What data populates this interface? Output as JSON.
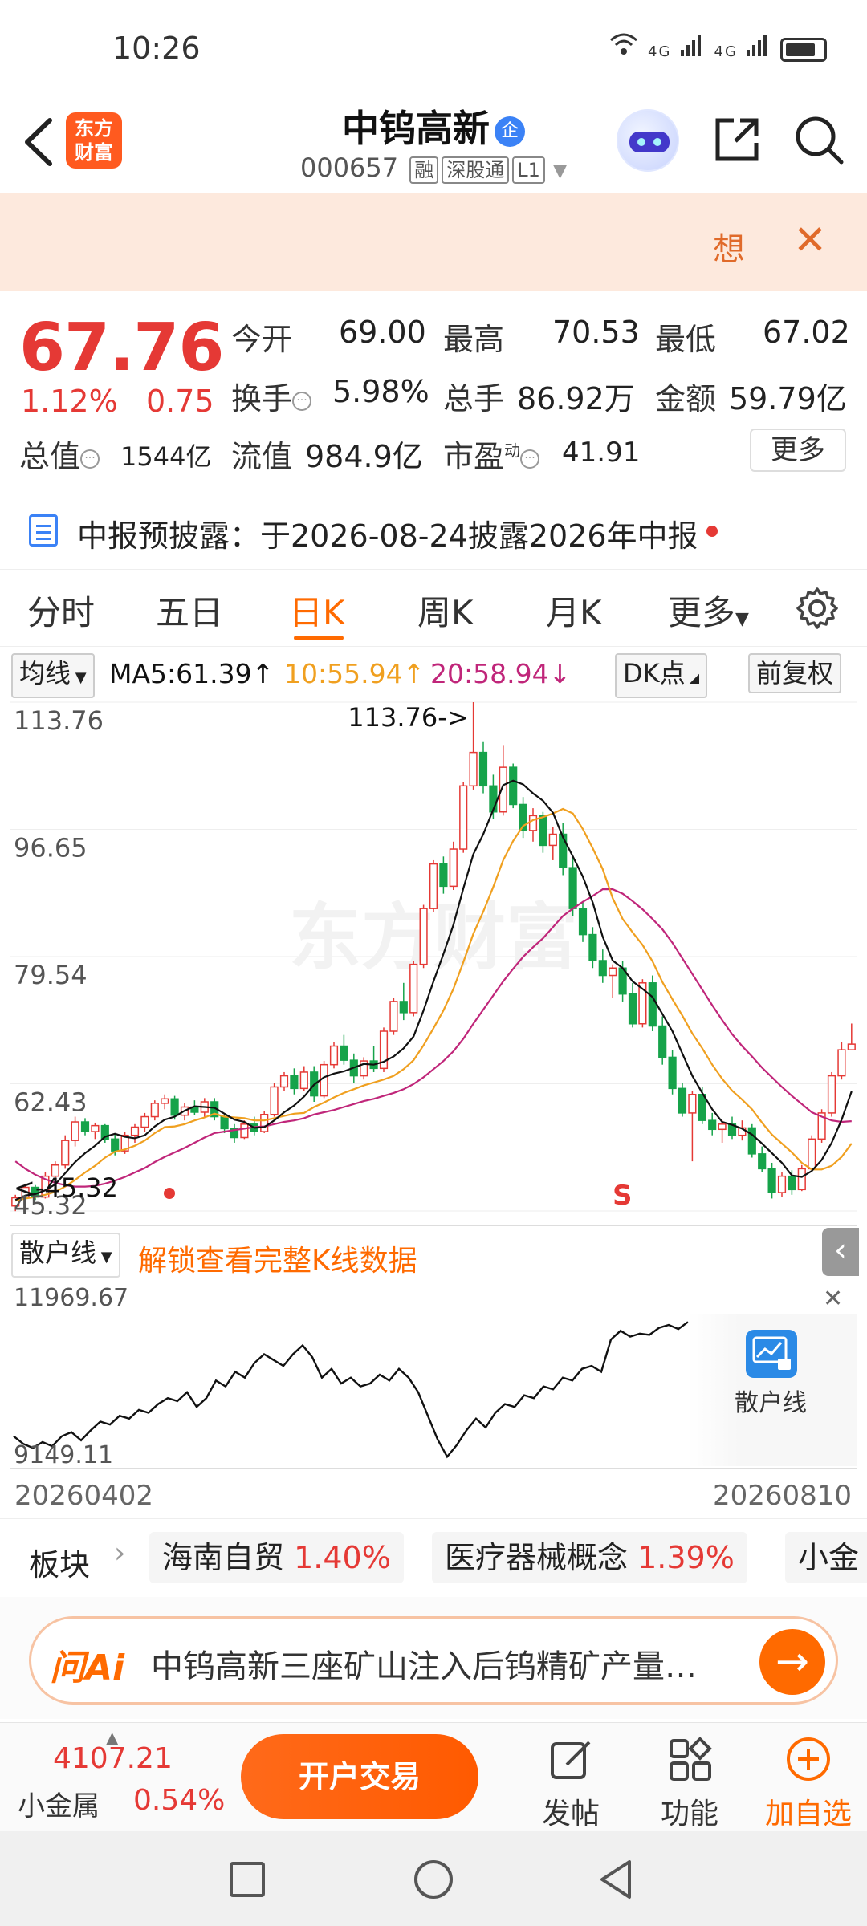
{
  "status_bar": {
    "time": "10:26",
    "network": "4G 4G"
  },
  "header": {
    "logo_text": "东方财富",
    "stock_name": "中钨高新",
    "badge": "企",
    "code": "000657",
    "tags": [
      "融",
      "深股通",
      "L1"
    ]
  },
  "banner": {
    "think_label": "想"
  },
  "quote": {
    "price": "67.76",
    "change_pct": "1.12%",
    "change": "0.75",
    "open_label": "今开",
    "open": "69.00",
    "high_label": "最高",
    "high": "70.53",
    "low_label": "最低",
    "low": "67.02",
    "turnover_label": "换手",
    "turnover": "5.98%",
    "volume_label": "总手",
    "volume": "86.92万",
    "amount_label": "金额",
    "amount": "59.79亿",
    "mktcap_label": "总值",
    "mktcap": "1544亿",
    "float_label": "流值",
    "float": "984.9亿",
    "pe_label": "市盈",
    "pe_sup": "动",
    "pe": "41.91",
    "more_label": "更多"
  },
  "notice": {
    "text": "中报预披露：于2026-08-24披露2026年中报"
  },
  "tabs": [
    {
      "label": "分时"
    },
    {
      "label": "五日"
    },
    {
      "label": "日K"
    },
    {
      "label": "周K"
    },
    {
      "label": "月K"
    },
    {
      "label": "更多"
    }
  ],
  "ma_row": {
    "selector": "均线",
    "ma5": "MA5:61.39↑",
    "ma10": "10:55.94↑",
    "ma20": "20:58.94↓",
    "dk": "DK点",
    "adjust": "前复权"
  },
  "colors": {
    "up": "#e53935",
    "down": "#16a34a",
    "ma5": "#111111",
    "ma10": "#f0a020",
    "ma20": "#c0267a",
    "accent": "#ff6a00"
  },
  "chart_data": {
    "type": "candlestick",
    "y_ticks": [
      "113.76",
      "96.65",
      "79.54",
      "62.43",
      "45.32"
    ],
    "ylim": [
      45.32,
      113.76
    ],
    "max_label": "113.76->",
    "min_label": "<-45.32",
    "signal": "S",
    "candles": [
      [
        46.0,
        47.5,
        45.3,
        47.1
      ],
      [
        47.1,
        49.0,
        46.5,
        48.5
      ],
      [
        48.5,
        48.8,
        46.8,
        47.2
      ],
      [
        47.2,
        50.5,
        47.0,
        50.0
      ],
      [
        50.0,
        52.0,
        49.5,
        51.5
      ],
      [
        51.5,
        55.5,
        51.0,
        54.8
      ],
      [
        54.8,
        58.0,
        54.0,
        57.3
      ],
      [
        57.3,
        57.8,
        55.5,
        56.0
      ],
      [
        56.0,
        57.2,
        55.0,
        56.8
      ],
      [
        56.8,
        57.0,
        54.5,
        55.0
      ],
      [
        55.0,
        55.6,
        52.8,
        53.4
      ],
      [
        53.4,
        56.0,
        53.0,
        55.5
      ],
      [
        55.5,
        57.0,
        54.5,
        56.6
      ],
      [
        56.6,
        58.5,
        56.0,
        58.0
      ],
      [
        58.0,
        60.2,
        57.5,
        59.8
      ],
      [
        59.8,
        61.0,
        59.0,
        60.4
      ],
      [
        60.4,
        60.8,
        57.6,
        58.2
      ],
      [
        58.2,
        59.8,
        57.5,
        59.3
      ],
      [
        59.3,
        60.2,
        58.2,
        58.6
      ],
      [
        58.6,
        60.5,
        58.0,
        60.0
      ],
      [
        60.0,
        60.5,
        57.5,
        58.0
      ],
      [
        58.0,
        58.3,
        55.8,
        56.4
      ],
      [
        56.4,
        57.0,
        54.5,
        55.2
      ],
      [
        55.2,
        57.5,
        55.0,
        57.0
      ],
      [
        57.0,
        58.0,
        55.5,
        56.0
      ],
      [
        56.0,
        58.8,
        55.8,
        58.3
      ],
      [
        58.3,
        62.5,
        58.0,
        62.0
      ],
      [
        62.0,
        64.0,
        61.5,
        63.5
      ],
      [
        63.5,
        64.5,
        61.0,
        61.8
      ],
      [
        61.8,
        64.8,
        61.5,
        64.0
      ],
      [
        64.0,
        64.8,
        60.0,
        60.8
      ],
      [
        60.8,
        65.5,
        60.5,
        65.0
      ],
      [
        65.0,
        68.0,
        64.5,
        67.5
      ],
      [
        67.5,
        69.0,
        65.0,
        65.6
      ],
      [
        65.6,
        66.5,
        62.5,
        63.5
      ],
      [
        63.5,
        66.0,
        63.0,
        65.5
      ],
      [
        65.5,
        67.5,
        64.0,
        64.5
      ],
      [
        64.5,
        70.0,
        64.0,
        69.5
      ],
      [
        69.5,
        74.0,
        69.0,
        73.5
      ],
      [
        73.5,
        76.0,
        71.0,
        72.0
      ],
      [
        72.0,
        79.0,
        71.5,
        78.5
      ],
      [
        78.5,
        86.5,
        78.0,
        86.0
      ],
      [
        86.0,
        92.5,
        85.5,
        92.0
      ],
      [
        92.0,
        93.0,
        88.0,
        89.0
      ],
      [
        89.0,
        95.0,
        88.5,
        94.0
      ],
      [
        94.0,
        103.0,
        93.5,
        102.5
      ],
      [
        102.5,
        113.76,
        102.0,
        107.0
      ],
      [
        107.0,
        108.5,
        101.5,
        102.5
      ],
      [
        102.5,
        104.0,
        98.0,
        99.0
      ],
      [
        99.0,
        108.0,
        98.5,
        105.0
      ],
      [
        105.0,
        105.5,
        99.5,
        100.0
      ],
      [
        100.0,
        101.0,
        95.5,
        96.5
      ],
      [
        96.5,
        99.5,
        95.0,
        98.5
      ],
      [
        98.5,
        99.0,
        93.5,
        94.5
      ],
      [
        94.5,
        97.0,
        92.5,
        96.0
      ],
      [
        96.0,
        97.5,
        90.5,
        91.5
      ],
      [
        91.5,
        93.0,
        85.0,
        86.0
      ],
      [
        86.0,
        87.0,
        81.5,
        82.5
      ],
      [
        82.5,
        83.5,
        78.0,
        79.0
      ],
      [
        79.0,
        80.5,
        76.0,
        77.0
      ],
      [
        77.0,
        78.5,
        74.0,
        78.0
      ],
      [
        78.0,
        79.0,
        73.5,
        74.5
      ],
      [
        74.5,
        76.0,
        70.0,
        70.5
      ],
      [
        70.5,
        76.5,
        70.0,
        76.0
      ],
      [
        76.0,
        77.0,
        69.5,
        70.2
      ],
      [
        70.2,
        71.5,
        65.0,
        66.0
      ],
      [
        66.0,
        67.0,
        61.0,
        61.8
      ],
      [
        61.8,
        62.5,
        58.0,
        58.5
      ],
      [
        58.5,
        61.5,
        52.0,
        61.0
      ],
      [
        61.0,
        62.0,
        57.0,
        57.5
      ],
      [
        57.5,
        58.5,
        55.5,
        56.3
      ],
      [
        56.3,
        57.5,
        54.5,
        57.0
      ],
      [
        57.0,
        58.0,
        55.0,
        55.5
      ],
      [
        55.5,
        57.5,
        54.8,
        56.5
      ],
      [
        56.5,
        57.0,
        52.5,
        53.0
      ],
      [
        53.0,
        54.0,
        50.5,
        51.0
      ],
      [
        51.0,
        51.8,
        47.0,
        47.8
      ],
      [
        47.8,
        50.5,
        47.2,
        50.0
      ],
      [
        50.0,
        50.8,
        47.5,
        48.2
      ],
      [
        48.2,
        51.5,
        48.0,
        51.0
      ],
      [
        51.0,
        55.5,
        50.8,
        55.0
      ],
      [
        55.0,
        59.0,
        54.5,
        58.5
      ],
      [
        58.5,
        64.0,
        58.0,
        63.5
      ],
      [
        63.5,
        68.0,
        63.0,
        67.0
      ],
      [
        67.0,
        70.53,
        67.02,
        67.76
      ]
    ],
    "ma5": [
      46.8,
      47.4,
      47.6,
      48.1,
      48.9,
      50.4,
      51.9,
      53.1,
      54.1,
      55.3,
      55.7,
      55.3,
      55.1,
      55.5,
      56.7,
      57.6,
      58.0,
      58.8,
      59.4,
      59.3,
      59.2,
      58.4,
      57.6,
      57.3,
      56.5,
      56.6,
      57.5,
      58.6,
      59.5,
      60.7,
      62.3,
      63.3,
      63.8,
      64.1,
      64.6,
      65.1,
      65.0,
      65.4,
      66.1,
      67.2,
      68.8,
      72.3,
      76.2,
      79.9,
      83.8,
      88.7,
      93.3,
      96.0,
      99.3,
      102.6,
      103.2,
      102.7,
      101.5,
      100.5,
      98.9,
      95.6,
      93.0,
      90.3,
      86.8,
      82.2,
      79.0,
      78.0,
      76.2,
      75.2,
      74.1,
      71.8,
      69.5,
      66.5,
      63.5,
      61.2,
      59.0,
      57.3,
      56.9,
      56.4,
      55.6,
      54.4,
      53.1,
      51.8,
      50.1,
      49.9,
      50.7,
      52.2,
      54.5,
      57.6,
      61.4
    ],
    "ma10": [
      46.7,
      47.0,
      47.2,
      47.5,
      47.9,
      48.6,
      49.5,
      50.5,
      51.4,
      52.5,
      53.3,
      53.6,
      54.1,
      54.8,
      55.8,
      56.6,
      56.7,
      57.0,
      57.5,
      57.9,
      58.4,
      58.0,
      57.9,
      57.8,
      57.5,
      57.5,
      57.8,
      58.1,
      58.4,
      58.5,
      59.3,
      59.9,
      60.6,
      61.2,
      61.7,
      62.2,
      62.6,
      63.0,
      63.5,
      64.4,
      65.6,
      67.6,
      69.9,
      72.3,
      75.2,
      78.8,
      82.6,
      85.6,
      88.9,
      92.5,
      95.1,
      97.1,
      97.9,
      98.3,
      98.8,
      99.4,
      98.8,
      96.7,
      94.1,
      91.3,
      87.4,
      84.6,
      82.8,
      81.1,
      78.9,
      76.1,
      73.8,
      71.6,
      69.2,
      67.2,
      65.0,
      63.1,
      61.5,
      60.3,
      59.0,
      57.2,
      55.6,
      54.4,
      53.2,
      51.8,
      50.9,
      50.9,
      51.4,
      52.6,
      54.4
    ],
    "ma20": [
      52.0,
      51.0,
      50.2,
      49.6,
      49.1,
      48.8,
      48.6,
      48.6,
      48.7,
      49.0,
      49.4,
      49.9,
      50.5,
      51.1,
      51.9,
      52.6,
      53.2,
      53.8,
      54.5,
      55.2,
      55.8,
      56.0,
      56.2,
      56.4,
      56.6,
      56.7,
      57.0,
      57.3,
      57.5,
      57.8,
      58.3,
      58.6,
      58.9,
      59.3,
      59.7,
      60.1,
      60.4,
      60.8,
      61.2,
      61.7,
      62.4,
      63.3,
      64.4,
      65.5,
      66.8,
      68.5,
      70.5,
      72.4,
      74.3,
      76.2,
      77.9,
      79.5,
      80.8,
      82.0,
      83.5,
      85.0,
      86.0,
      86.9,
      87.7,
      88.6,
      88.6,
      88.0,
      87.0,
      85.9,
      84.6,
      83.2,
      81.4,
      79.3,
      77.2,
      75.1,
      73.0,
      71.0,
      69.1,
      67.5,
      66.1,
      64.6,
      63.3,
      62.0,
      60.8,
      59.7,
      58.6,
      58.0,
      57.5,
      57.3,
      57.4
    ]
  },
  "indicator": {
    "selector": "散户线",
    "unlock": "解锁查看完整K线数据"
  },
  "retail_chart": {
    "type": "line",
    "y_ticks": [
      "11969.67",
      "9149.11"
    ],
    "ylim": [
      9149.11,
      11969.67
    ],
    "series": [
      {
        "values": [
          9550,
          9420,
          9350,
          9450,
          9380,
          9550,
          9620,
          9480,
          9650,
          9800,
          9750,
          9900,
          9850,
          10000,
          9950,
          10100,
          10200,
          10150,
          10300,
          10050,
          10200,
          10500,
          10400,
          10650,
          10550,
          10800,
          10950,
          10850,
          10750,
          10950,
          11100,
          10900,
          10550,
          10700,
          10450,
          10550,
          10400,
          10450,
          10600,
          10500,
          10700,
          10550,
          10300,
          9900,
          9500,
          9200,
          9400,
          9650,
          9850,
          9700,
          9950,
          10100,
          10050,
          10250,
          10200,
          10400,
          10350,
          10550,
          10500,
          10700,
          10750,
          10650,
          11200,
          11350,
          11250,
          11300,
          11280,
          11400,
          11450,
          11380,
          11500
        ]
      }
    ],
    "lock_label": "散户线"
  },
  "date_axis": {
    "start": "20260402",
    "end": "20260810"
  },
  "sectors": {
    "label": "板块",
    "items": [
      {
        "name": "海南自贸",
        "pct": "1.40%"
      },
      {
        "name": "医疗器械概念",
        "pct": "1.39%"
      },
      {
        "name": "小金",
        "pct": ""
      }
    ]
  },
  "ai_bar": {
    "logo": "问Ai",
    "text": "中钨高新三座矿山注入后钨精矿产量…"
  },
  "bottom_bar": {
    "index_value": "4107.21",
    "index_name": "小金属",
    "index_pct": "0.54%",
    "open_account": "开户交易",
    "post": "发帖",
    "functions": "功能",
    "add_watch": "加自选"
  },
  "watermark": "东方财富"
}
